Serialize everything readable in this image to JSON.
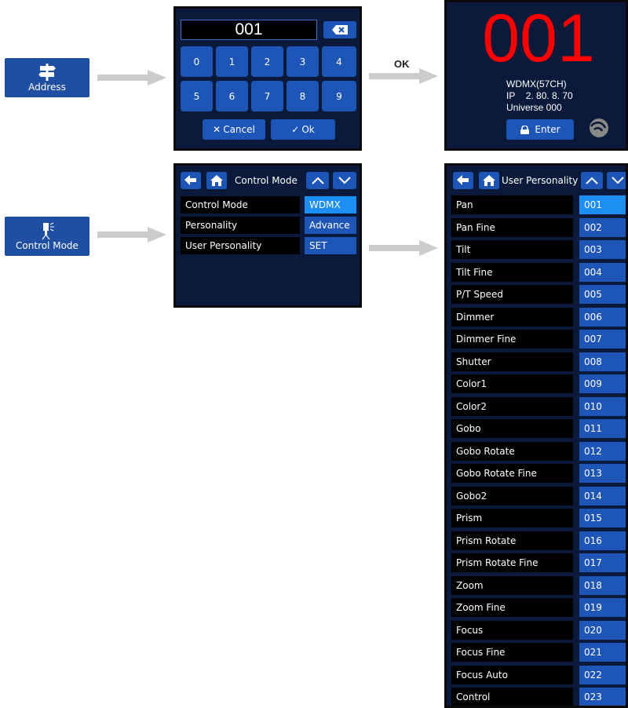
{
  "colors": {
    "screen_bg": "#0b1a3a",
    "button_blue": "#1e56b8",
    "selected_blue": "#1d8ef2",
    "big_number_red": "#ff0000",
    "tile_blue": "#1f4fa3",
    "arrow_grey": "#cccccc"
  },
  "tiles": {
    "address_label": "Address",
    "control_mode_label": "Control Mode"
  },
  "arrow_ok_label": "OK",
  "keypad": {
    "display_value": "001",
    "keys": [
      "0",
      "1",
      "2",
      "3",
      "4",
      "5",
      "6",
      "7",
      "8",
      "9"
    ],
    "cancel_label": "Cancel",
    "ok_label": "Ok",
    "backspace_icon": "backspace-icon"
  },
  "address_result": {
    "big_number": "001",
    "mode": "WDMX(57CH)",
    "ip_label": "IP",
    "ip_value": "2. 80. 8. 70",
    "universe": "Universe 000",
    "enter_label": "Enter"
  },
  "control_mode_screen": {
    "title": "Control Mode",
    "rows": [
      {
        "label": "Control Mode",
        "value": "WDMX",
        "selected": true
      },
      {
        "label": "Personality",
        "value": "Advance",
        "selected": false
      },
      {
        "label": "User Personality",
        "value": "SET",
        "selected": false
      }
    ]
  },
  "user_personality_screen": {
    "title": "User Personality",
    "rows": [
      {
        "label": "Pan",
        "value": "001"
      },
      {
        "label": "Pan Fine",
        "value": "002"
      },
      {
        "label": "Tilt",
        "value": "003"
      },
      {
        "label": "Tilt Fine",
        "value": "004"
      },
      {
        "label": "P/T Speed",
        "value": "005"
      },
      {
        "label": "Dimmer",
        "value": "006"
      },
      {
        "label": "Dimmer Fine",
        "value": "007"
      },
      {
        "label": "Shutter",
        "value": "008"
      },
      {
        "label": "Color1",
        "value": "009"
      },
      {
        "label": "Color2",
        "value": "010"
      },
      {
        "label": "Gobo",
        "value": "011"
      },
      {
        "label": "Gobo Rotate",
        "value": "012"
      },
      {
        "label": "Gobo Rotate Fine",
        "value": "013"
      },
      {
        "label": "Gobo2",
        "value": "014"
      },
      {
        "label": "Prism",
        "value": "015"
      },
      {
        "label": "Prism Rotate",
        "value": "016"
      },
      {
        "label": "Prism Rotate Fine",
        "value": "017"
      },
      {
        "label": "Zoom",
        "value": "018"
      },
      {
        "label": "Zoom Fine",
        "value": "019"
      },
      {
        "label": "Focus",
        "value": "020"
      },
      {
        "label": "Focus Fine",
        "value": "021"
      },
      {
        "label": "Focus Auto",
        "value": "022"
      },
      {
        "label": "Control",
        "value": "023"
      }
    ]
  }
}
